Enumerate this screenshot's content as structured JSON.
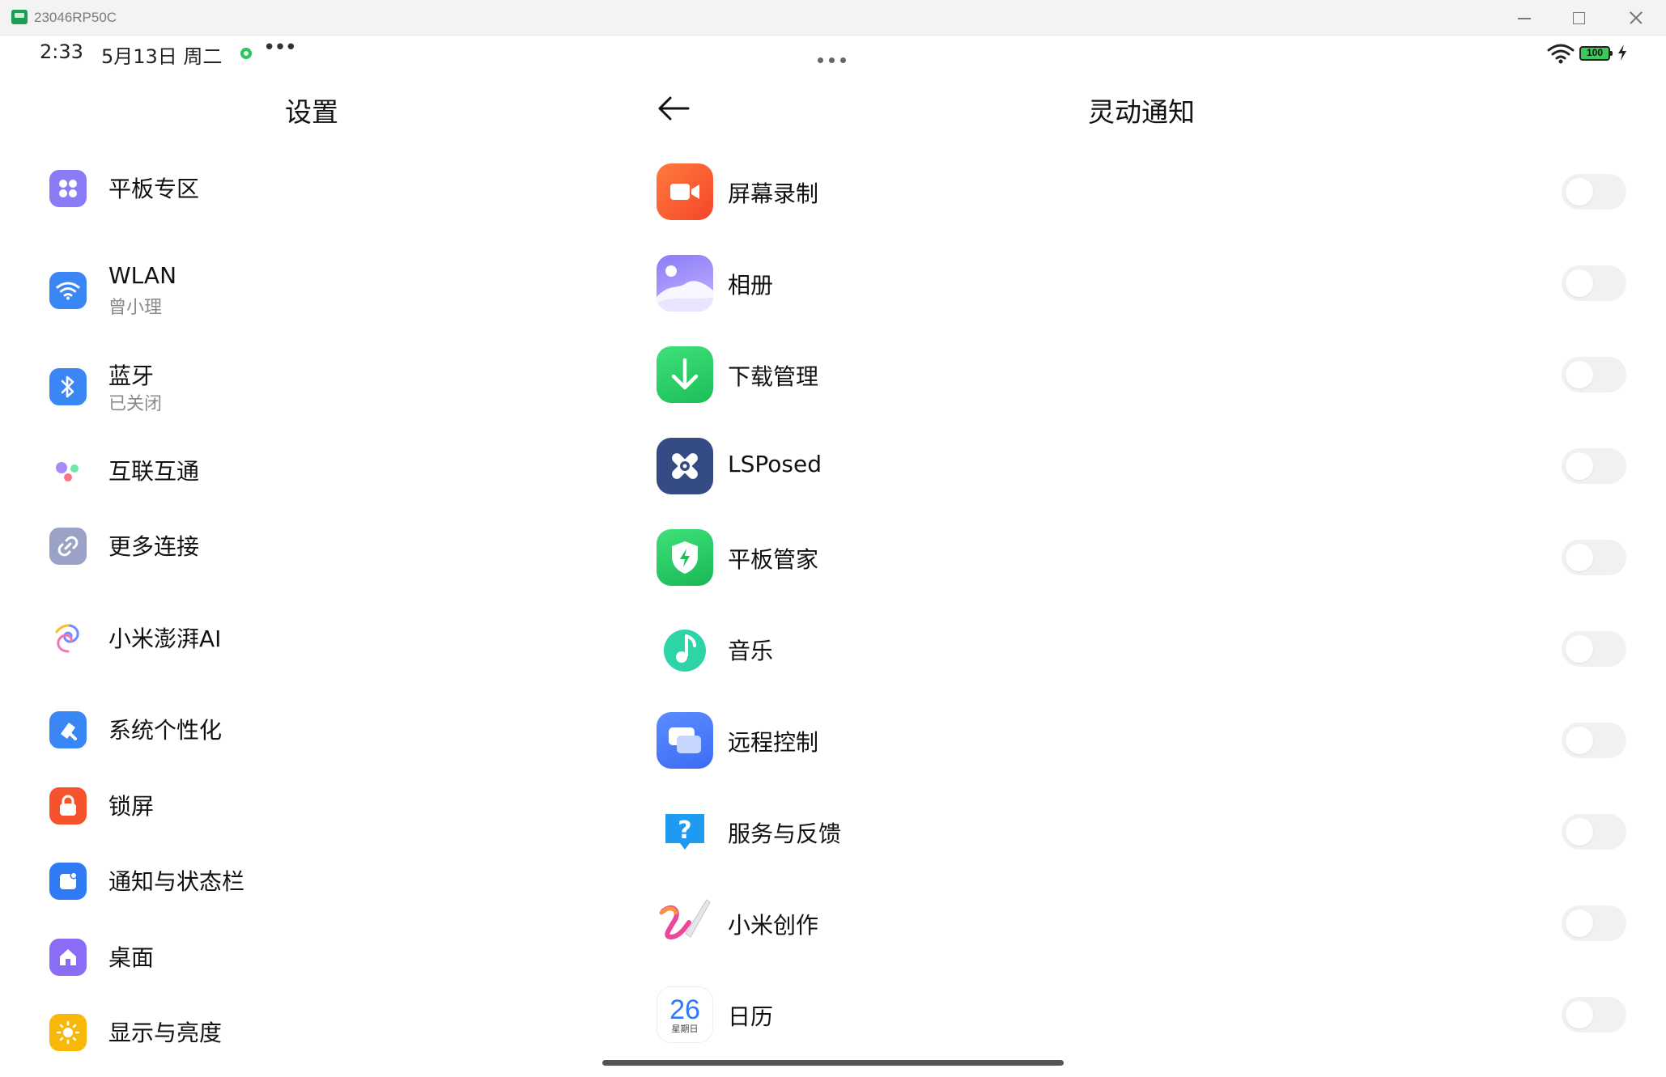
{
  "window": {
    "title": "23046RP50C"
  },
  "status_bar": {
    "time": "2:33",
    "date": "5月13日 周二",
    "more": "•••",
    "battery": "100"
  },
  "left_panel": {
    "title": "设置",
    "items": [
      {
        "label": "平板专区",
        "sub": "",
        "icon": "tablet-zone-icon",
        "color": "#8a7cf6"
      },
      {
        "label": "WLAN",
        "sub": "曾小理",
        "icon": "wifi-icon",
        "color": "#3b86f5"
      },
      {
        "label": "蓝牙",
        "sub": "已关闭",
        "icon": "bluetooth-icon",
        "color": "#3b86f5"
      },
      {
        "label": "互联互通",
        "sub": "",
        "icon": "interconnect-icon",
        "color": "#a78bfa"
      },
      {
        "label": "更多连接",
        "sub": "",
        "icon": "link-icon",
        "color": "#9aa3c7"
      },
      {
        "label": "小米澎湃AI",
        "sub": "",
        "icon": "hyper-ai-icon",
        "color": "#6c8cff"
      },
      {
        "label": "系统个性化",
        "sub": "",
        "icon": "brush-icon",
        "color": "#3b86f5"
      },
      {
        "label": "锁屏",
        "sub": "",
        "icon": "lock-icon",
        "color": "#f5532d"
      },
      {
        "label": "通知与状态栏",
        "sub": "",
        "icon": "notification-icon",
        "color": "#2f7bf5"
      },
      {
        "label": "桌面",
        "sub": "",
        "icon": "home-icon",
        "color": "#8a6cf6"
      },
      {
        "label": "显示与亮度",
        "sub": "",
        "icon": "brightness-icon",
        "color": "#f8b808"
      }
    ]
  },
  "right_panel": {
    "title": "灵动通知",
    "apps": [
      {
        "label": "屏幕录制",
        "icon": "screen-record-icon",
        "enabled": false
      },
      {
        "label": "相册",
        "icon": "gallery-icon",
        "enabled": false
      },
      {
        "label": "下载管理",
        "icon": "download-icon",
        "enabled": false
      },
      {
        "label": "LSPosed",
        "icon": "lsposed-icon",
        "enabled": false
      },
      {
        "label": "平板管家",
        "icon": "security-icon",
        "enabled": false
      },
      {
        "label": "音乐",
        "icon": "music-icon",
        "enabled": false
      },
      {
        "label": "远程控制",
        "icon": "remote-control-icon",
        "enabled": false
      },
      {
        "label": "服务与反馈",
        "icon": "feedback-icon",
        "enabled": false
      },
      {
        "label": "小米创作",
        "icon": "creation-icon",
        "enabled": false
      },
      {
        "label": "日历",
        "icon": "calendar-icon",
        "enabled": false,
        "icon_day": "26",
        "icon_weekday": "星期日"
      }
    ]
  }
}
